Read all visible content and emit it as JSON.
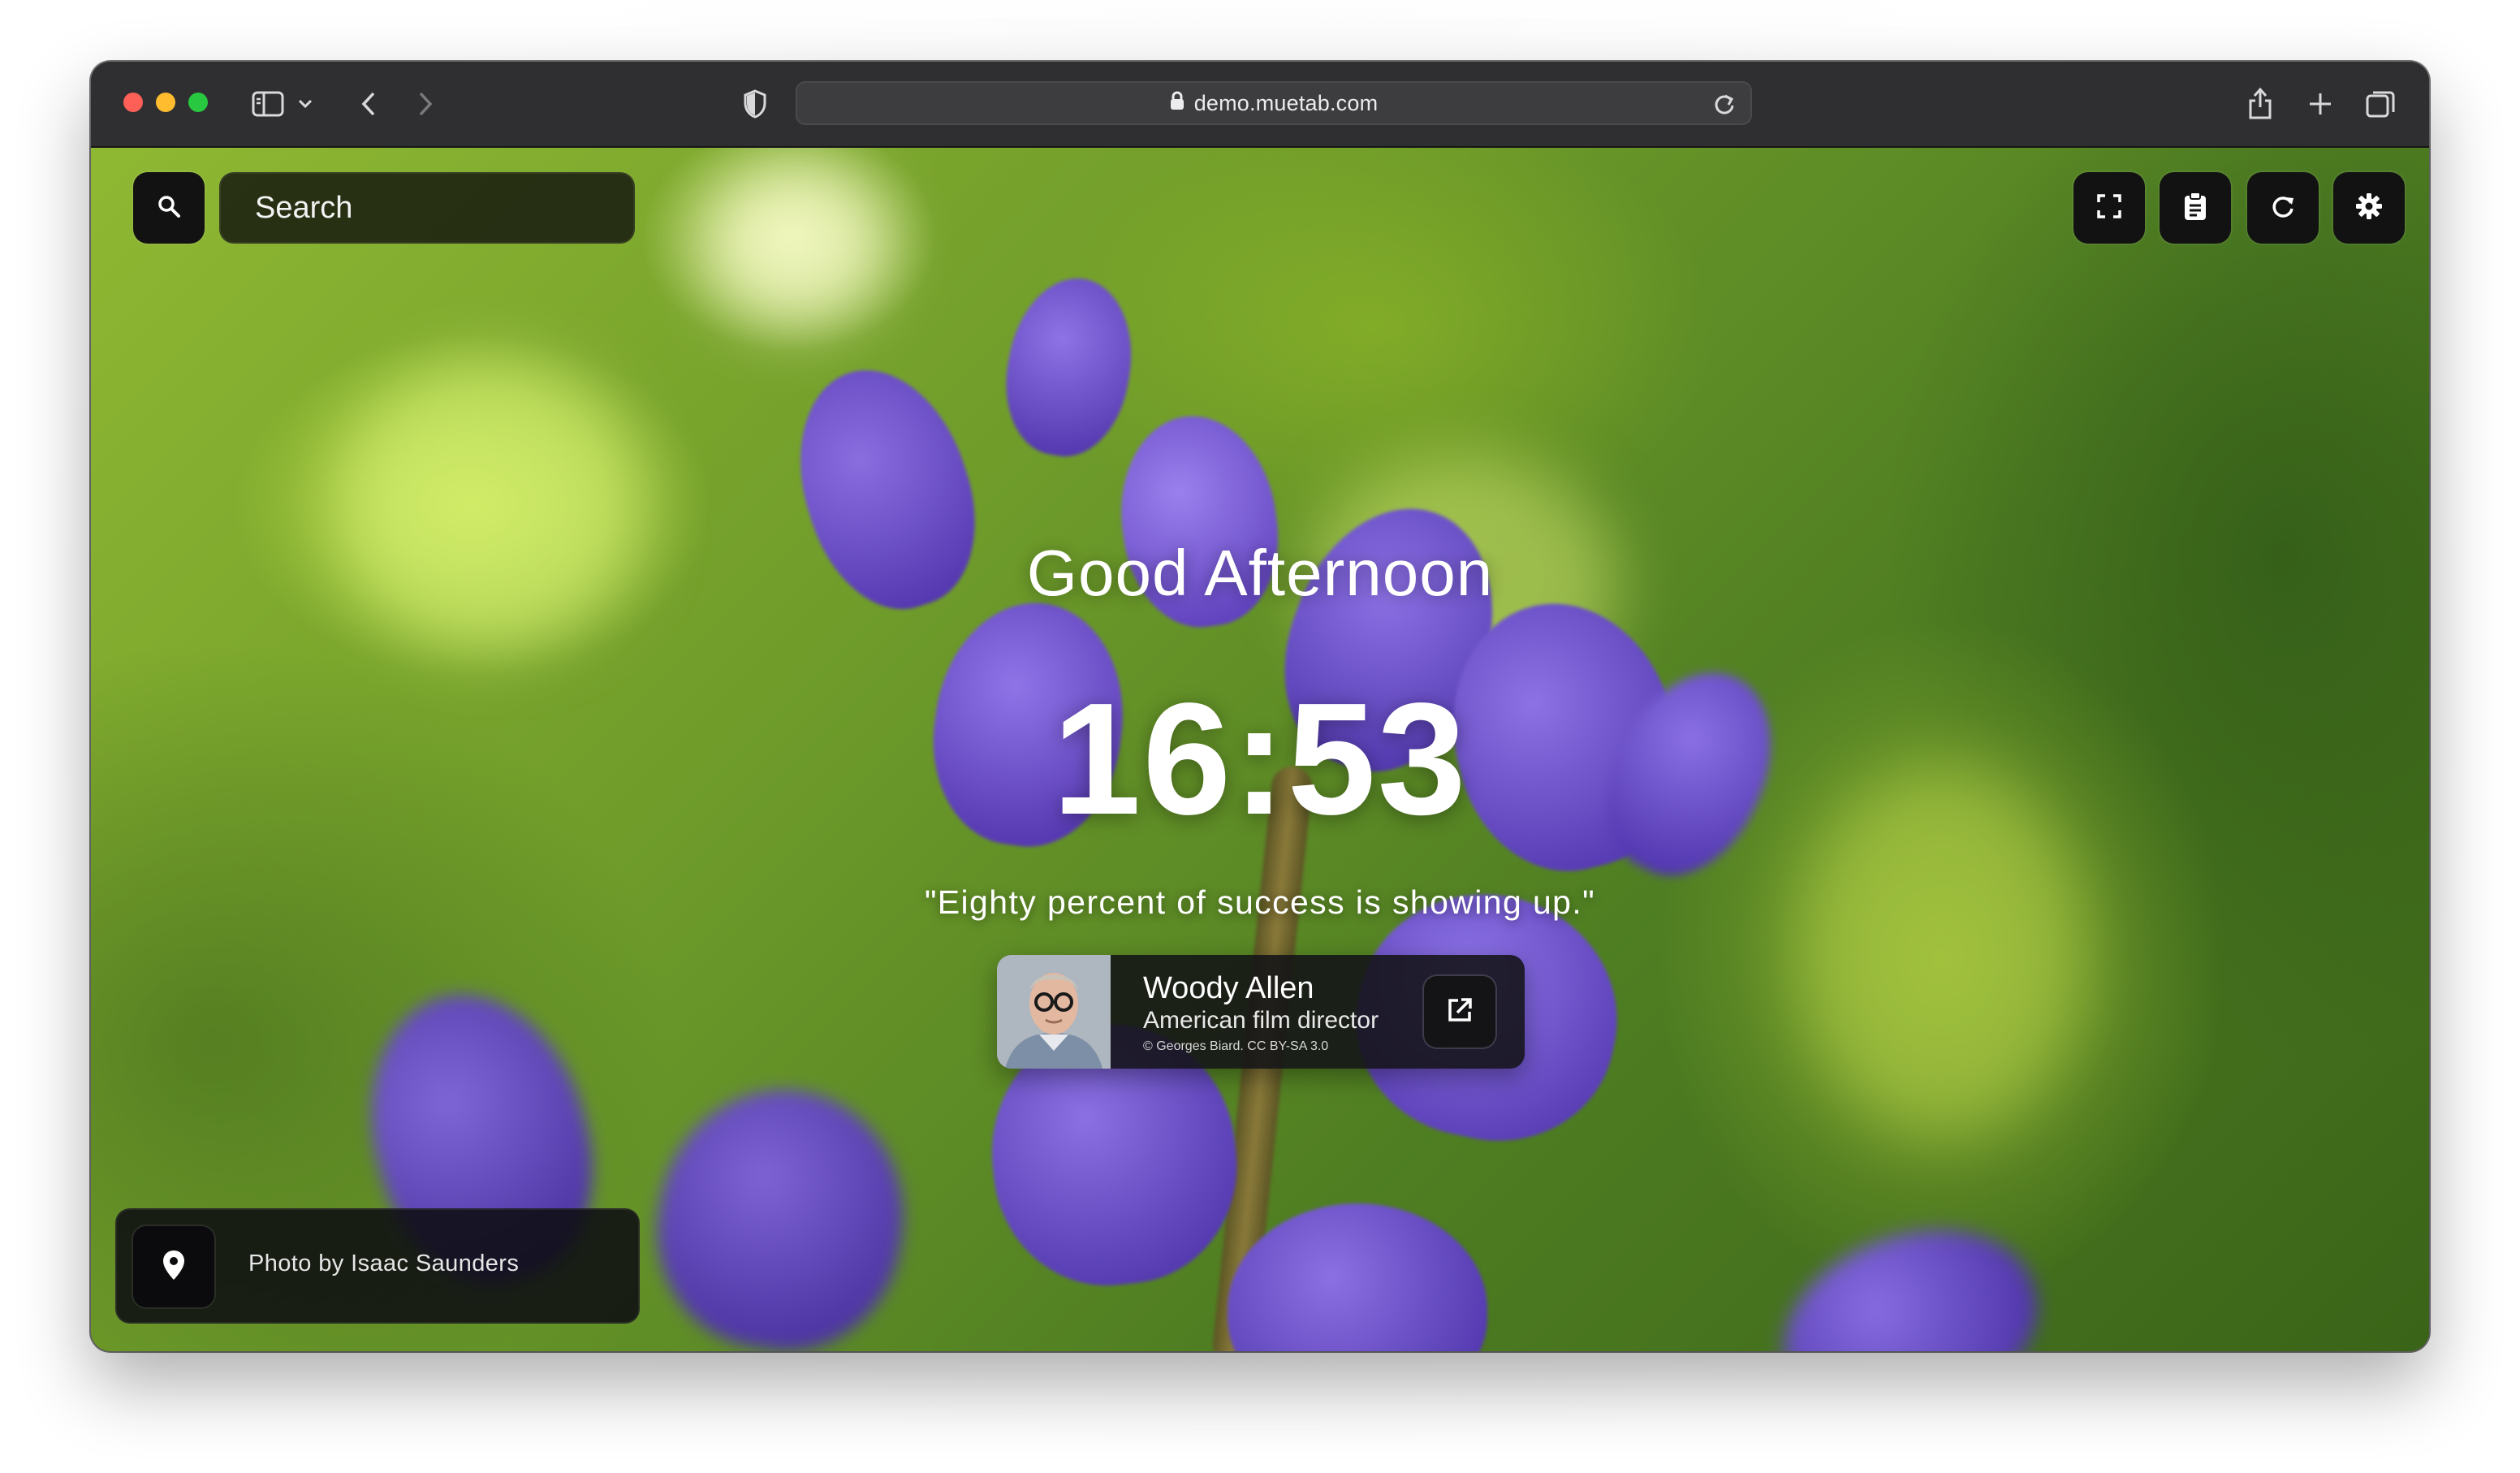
{
  "browser": {
    "url": "demo.muetab.com"
  },
  "search": {
    "placeholder": "Search"
  },
  "greeting": "Good Afternoon",
  "clock": "16:53",
  "quote": {
    "text": "\"Eighty percent of success is showing up.\"",
    "author": "Woody Allen",
    "author_role": "American film director",
    "photo_credit": "© Georges Biard. CC BY-SA 3.0"
  },
  "background": {
    "credit": "Photo by Isaac Saunders"
  },
  "icons": {
    "search": "search-icon",
    "fullscreen": "fullscreen-icon",
    "notes": "clipboard-icon",
    "refresh": "refresh-icon",
    "settings": "gear-icon",
    "open_link": "external-link-icon",
    "location": "map-pin-icon"
  },
  "colors": {
    "traffic_red": "#fe5f57",
    "traffic_yellow": "#febc2e",
    "traffic_green": "#28c840",
    "widget_bg": "#121212"
  }
}
